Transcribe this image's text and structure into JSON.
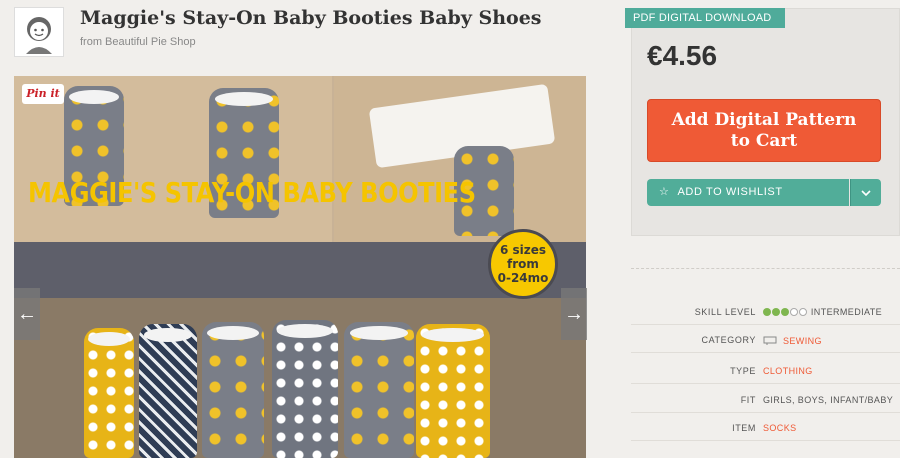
{
  "product": {
    "title": "Maggie's Stay-On Baby Booties Baby Shoes",
    "byline": "from Beautiful Pie Shop"
  },
  "image": {
    "pin_label": "Pin it",
    "banner_text": "MAGGIE'S STAY-ON BABY BOOTIES",
    "badge_line1": "6 sizes",
    "badge_line2": "from",
    "badge_line3": "0-24mo",
    "prev_arrow": "←",
    "next_arrow": "→"
  },
  "purchase": {
    "format_tag": "PDF DIGITAL DOWNLOAD",
    "price": "€4.56",
    "add_line1": "Add Digital Pattern",
    "add_line2": "to Cart",
    "wishlist_label": "ADD TO WISHLIST",
    "wishlist_dropdown": "⌄"
  },
  "details": {
    "skill_label": "SKILL LEVEL",
    "skill_value": "INTERMEDIATE",
    "skill_level": 3,
    "skill_max": 5,
    "category_label": "CATEGORY",
    "category_value": "SEWING",
    "type_label": "TYPE",
    "type_value": "CLOTHING",
    "fit_label": "FIT",
    "fit_value": "GIRLS, BOYS, INFANT/BABY",
    "item_label": "ITEM",
    "item_value": "SOCKS"
  },
  "colors": {
    "accent_orange": "#ef5a36",
    "accent_teal": "#51ad99",
    "skill_green": "#7fb64f"
  }
}
